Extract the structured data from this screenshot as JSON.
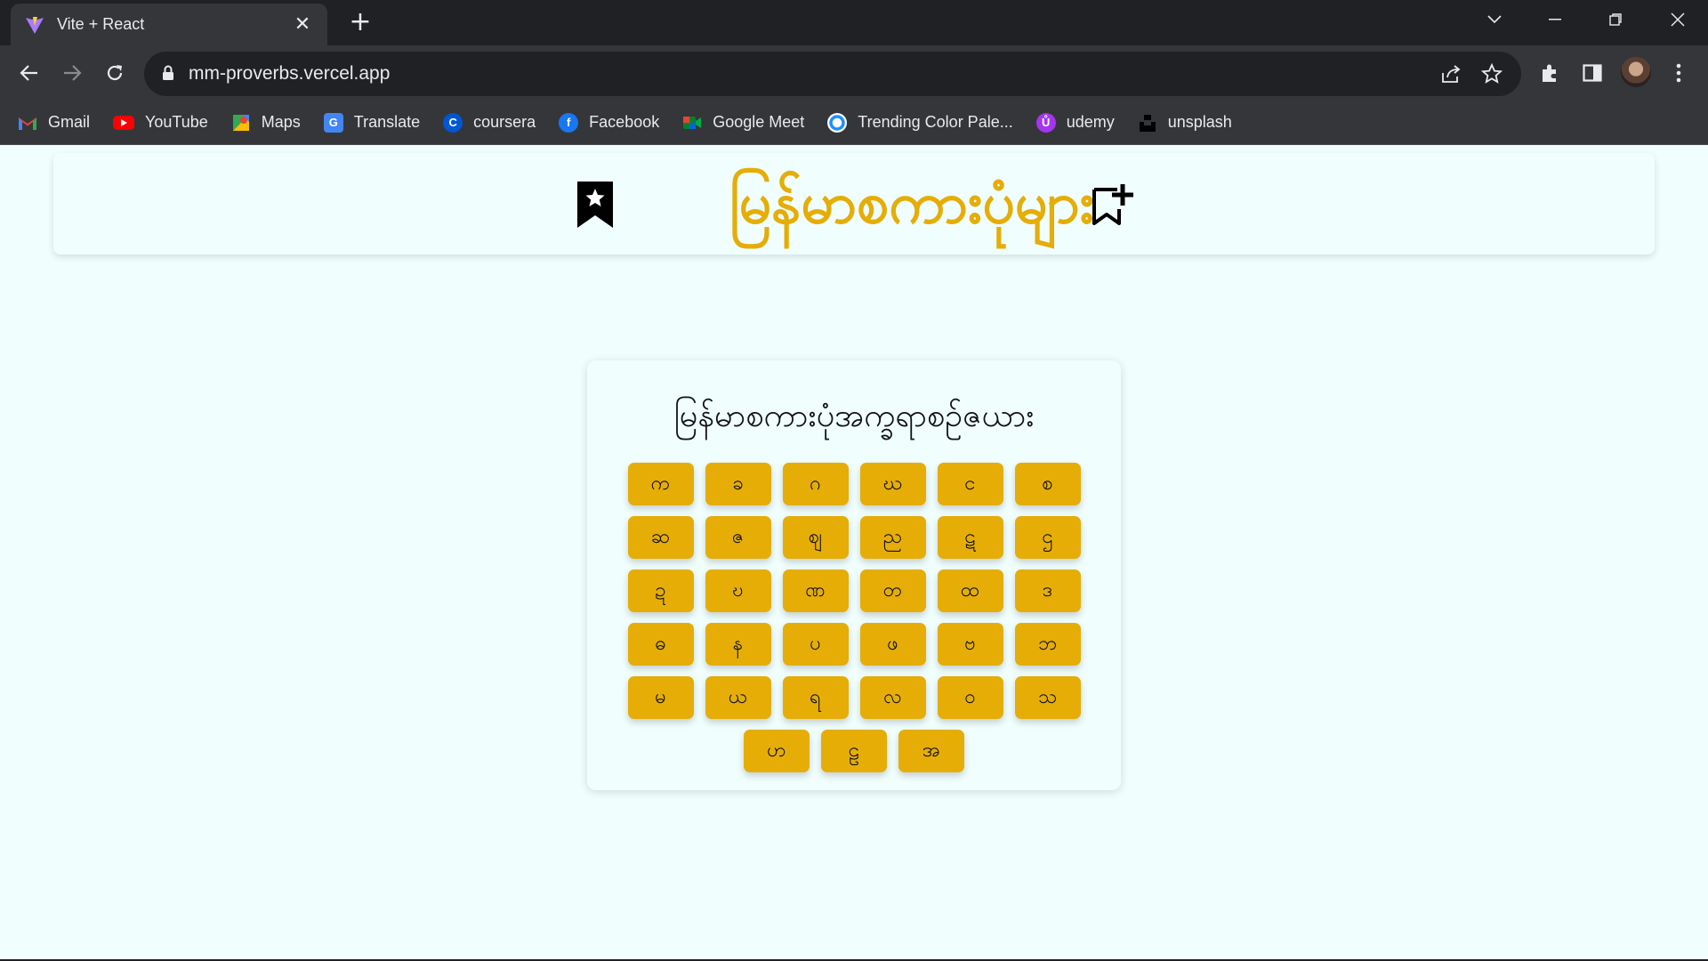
{
  "browser": {
    "tab_title": "Vite + React",
    "tab_close": "✕",
    "new_tab": "+",
    "url": "mm-proverbs.vercel.app"
  },
  "bookmarks": [
    {
      "label": "Gmail",
      "icon": "gmail-icon"
    },
    {
      "label": "YouTube",
      "icon": "youtube-icon"
    },
    {
      "label": "Maps",
      "icon": "maps-icon"
    },
    {
      "label": "Translate",
      "icon": "translate-icon"
    },
    {
      "label": "coursera",
      "icon": "coursera-icon"
    },
    {
      "label": "Facebook",
      "icon": "facebook-icon"
    },
    {
      "label": "Google Meet",
      "icon": "google-meet-icon"
    },
    {
      "label": "Trending Color Pale...",
      "icon": "color-palette-icon"
    },
    {
      "label": "udemy",
      "icon": "udemy-icon"
    },
    {
      "label": "unsplash",
      "icon": "unsplash-icon"
    }
  ],
  "header": {
    "title": "မြန်မာစကားပုံများ",
    "left_icon": "bookmark-star-icon",
    "right_icon": "bookmark-add-icon"
  },
  "alphabet": {
    "title": "မြန်မာစကားပုံအက္ခရာစဉ်ဇယား",
    "letters": [
      "က",
      "ခ",
      "ဂ",
      "ဃ",
      "င",
      "စ",
      "ဆ",
      "ဇ",
      "ဈ",
      "ည",
      "ဋ",
      "ဌ",
      "ဍ",
      "ဎ",
      "ဏ",
      "တ",
      "ထ",
      "ဒ",
      "ဓ",
      "န",
      "ပ",
      "ဖ",
      "ဗ",
      "ဘ",
      "မ",
      "ယ",
      "ရ",
      "လ",
      "ဝ",
      "သ",
      "ဟ",
      "ဠ",
      "အ"
    ]
  },
  "colors": {
    "accent": "#e5ad06",
    "page_bg": "#f0fefe",
    "chrome_dark": "#202124",
    "chrome_mid": "#35363a"
  }
}
